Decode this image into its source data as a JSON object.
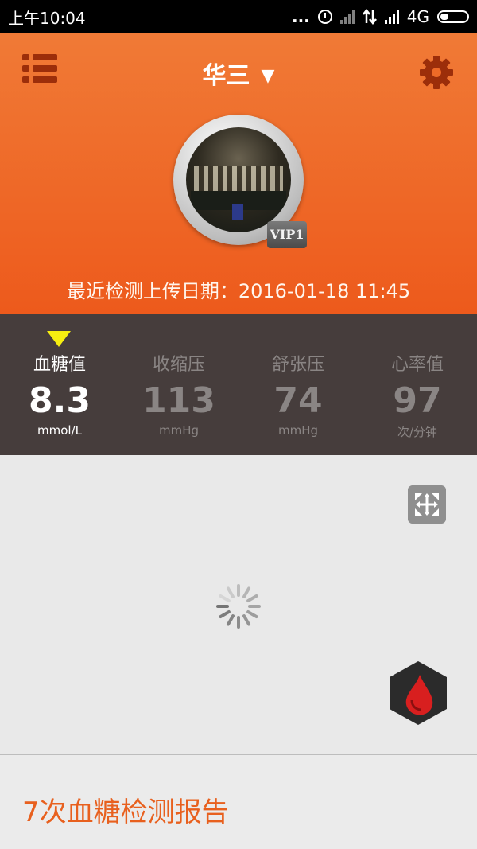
{
  "status_bar": {
    "time": "上午10:04",
    "dots": "...",
    "network": "4G",
    "icons": [
      "alarm-icon",
      "signal-x-icon",
      "data-arrows-icon",
      "signal-icon",
      "battery-icon"
    ]
  },
  "header": {
    "user_name": "华三",
    "dropdown_icon": "▼",
    "vip_badge": "VIP1",
    "upload_label": "最近检测上传日期：",
    "upload_datetime": "2016-01-18 11:45",
    "colors": {
      "bg_top": "#f07a36",
      "bg_bottom": "#ed5a1c"
    }
  },
  "metrics": [
    {
      "label": "血糖值",
      "value": "8.3",
      "unit": "mmol/L",
      "active": true
    },
    {
      "label": "收缩压",
      "value": "113",
      "unit": "mmHg",
      "active": false
    },
    {
      "label": "舒张压",
      "value": "74",
      "unit": "mmHg",
      "active": false
    },
    {
      "label": "心率值",
      "value": "97",
      "unit": "次/分钟",
      "active": false
    }
  ],
  "report": {
    "title": "7次血糖检测报告",
    "accent_color": "#e8601e"
  }
}
